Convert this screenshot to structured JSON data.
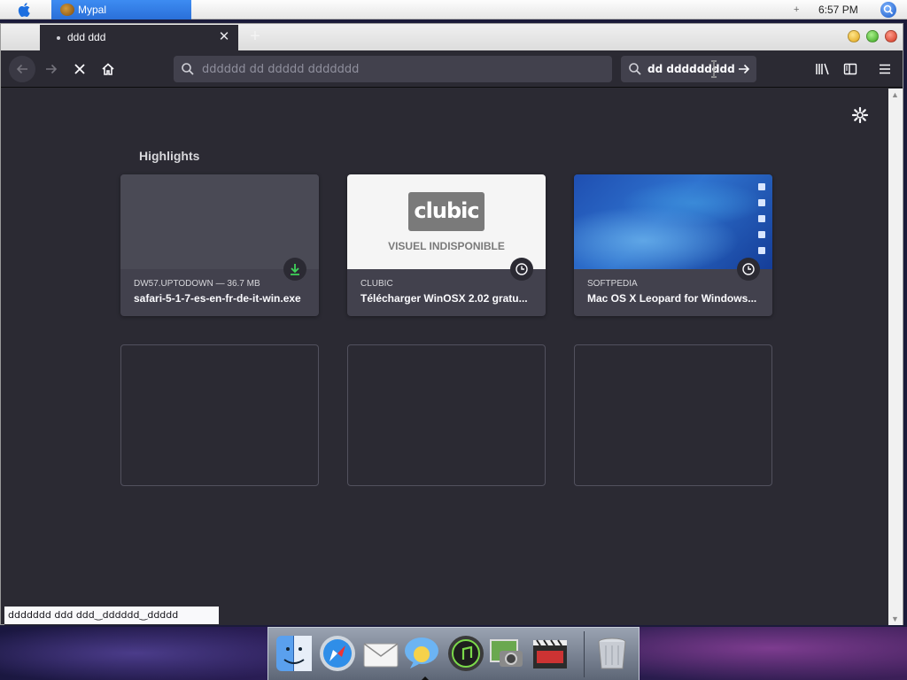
{
  "menubar": {
    "app_name": "Mypal",
    "plus": "+",
    "clock": "6:57 PM"
  },
  "tabs": {
    "active_title": "ddd ddd",
    "new_tab": "+"
  },
  "toolbar": {
    "url_placeholder": "dddddd dd ddddd ddddddd",
    "search_value": "dd ddddddddd"
  },
  "content": {
    "highlights_label": "Highlights",
    "cards": [
      {
        "source": "DW57.UPTODOWN — 36.7 MB",
        "title": "safari-5-1-7-es-en-fr-de-it-win.exe",
        "badge": "download-icon"
      },
      {
        "source": "CLUBIC",
        "title": "Télécharger WinOSX 2.02 gratu...",
        "badge": "clock-icon",
        "logo_text": "clubic",
        "thumb_text": "VISUEL INDISPONIBLE"
      },
      {
        "source": "SOFTPEDIA",
        "title": "Mac OS X Leopard for Windows...",
        "badge": "clock-icon"
      }
    ]
  },
  "status_panel": {
    "text": "ddddddd ddd ddd‿dddddd‿ddddd"
  },
  "colors": {
    "content_bg": "#2b2a33",
    "card_bg": "#42414d",
    "accent_download": "#3fd45a",
    "tab_active_bg": "#2b2a33",
    "menubar_app_tab": "#2a6fd8"
  },
  "dock": {
    "items": [
      "finder-icon",
      "safari-icon",
      "mail-icon",
      "ichat-icon",
      "itunes-icon",
      "iphoto-icon",
      "imovie-icon",
      "trash-icon"
    ]
  }
}
